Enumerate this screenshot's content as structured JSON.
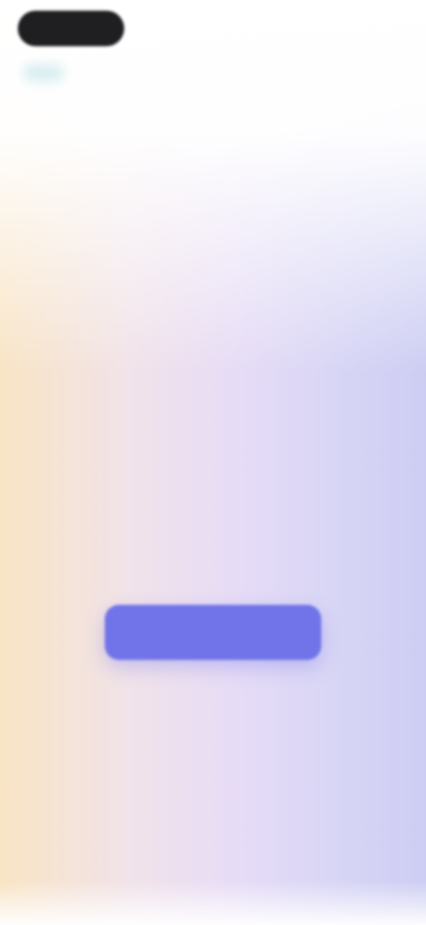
{
  "header": {
    "logo_text": "",
    "nav_label": ""
  },
  "hero": {
    "title": "",
    "body": ""
  },
  "actions": {
    "primary_label": "",
    "secondary_label": ""
  },
  "colors": {
    "primary_button": "#7174e8",
    "logo_background": "#1f1f22",
    "gradient_left": "#f9e4c4",
    "gradient_right": "#cdcdf3"
  }
}
